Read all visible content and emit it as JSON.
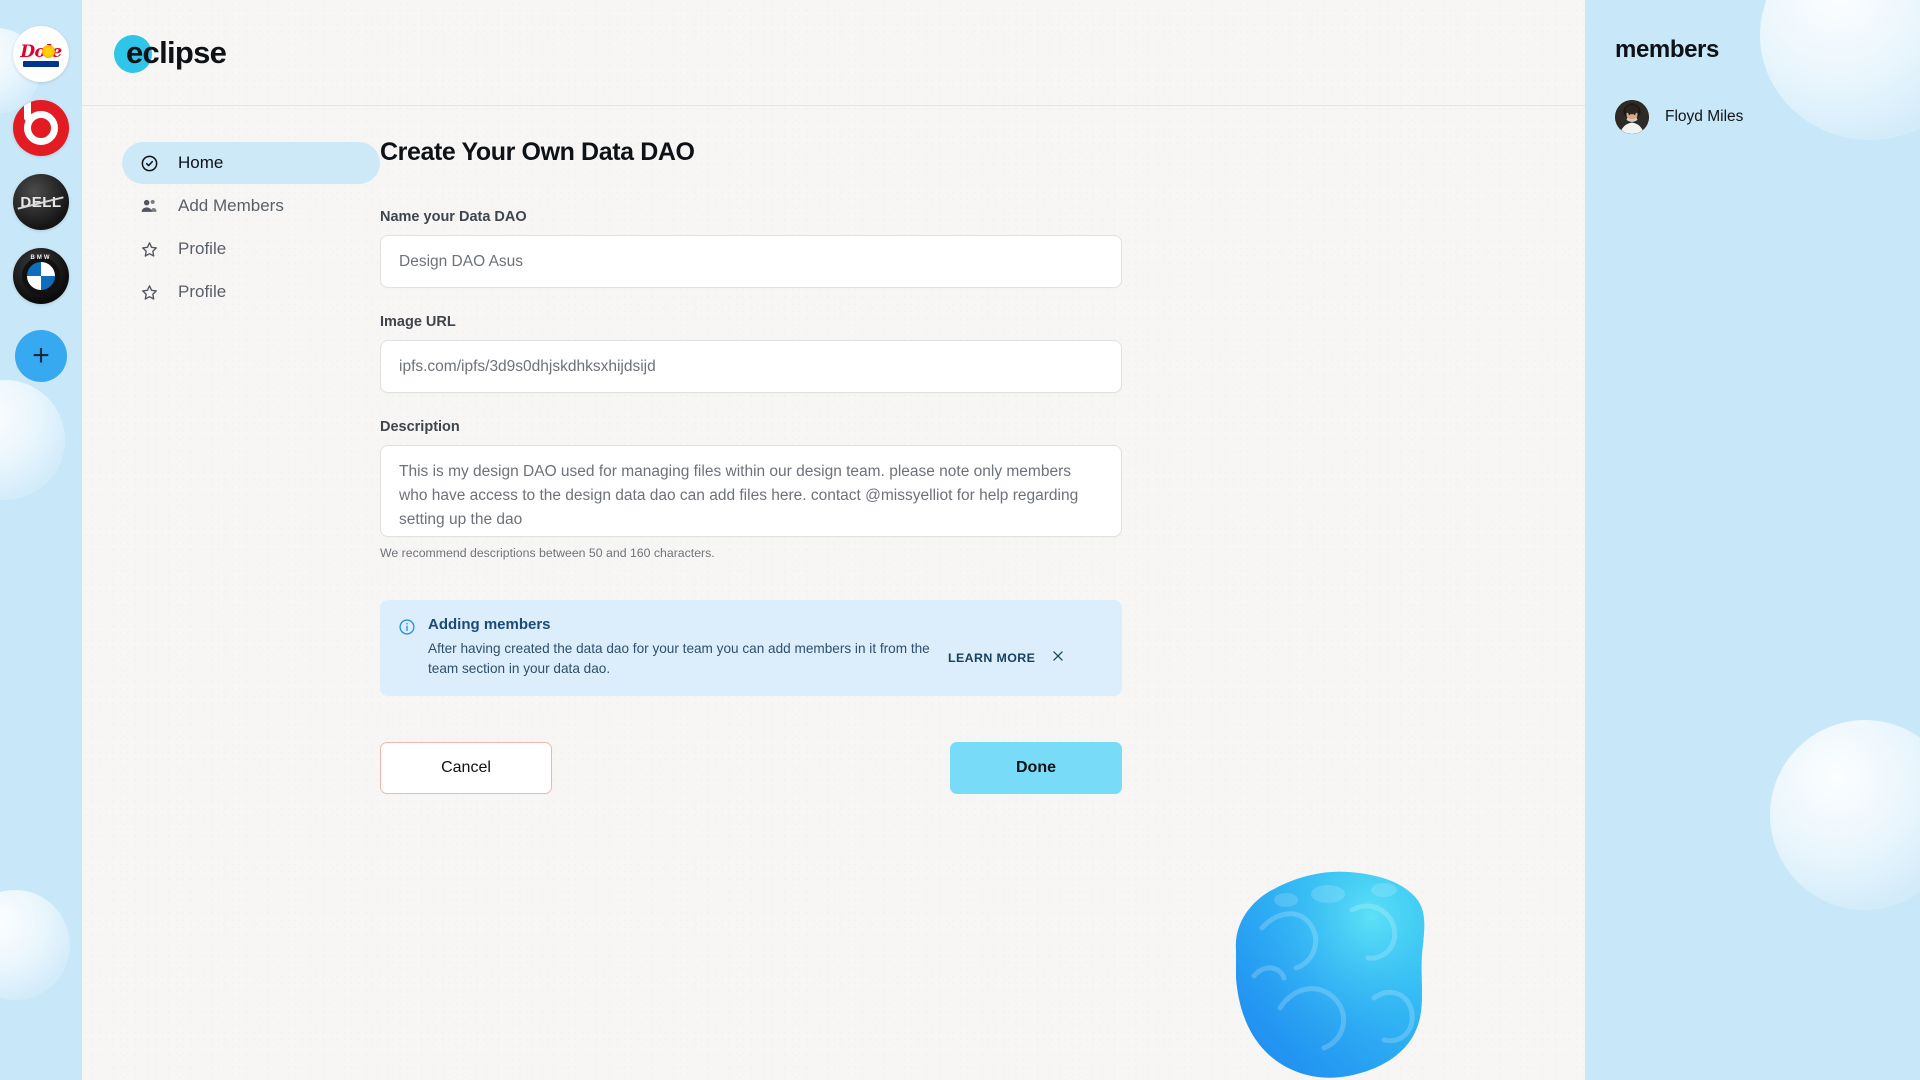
{
  "colors": {
    "page_background": "#c8e7f8",
    "panel_background": "#f7f6f5",
    "accent_cyan": "#2ec5e8",
    "nav_active_pill": "#cde9f8",
    "banner_background": "#dceefc",
    "done_button": "#78dcf8",
    "cancel_border": "#f0b6ae",
    "add_button": "#36a9f0"
  },
  "app_rail": {
    "logos": [
      {
        "name": "dole-logo",
        "label": "Dole"
      },
      {
        "name": "beats-logo",
        "label": "Beats"
      },
      {
        "name": "dell-logo",
        "label": "DELL"
      },
      {
        "name": "bmw-logo",
        "label": "BMW"
      }
    ],
    "add_button_label": "+"
  },
  "header": {
    "logo_text": "eclipse",
    "logo_icon": "circle-dot-icon"
  },
  "sidebar": {
    "items": [
      {
        "label": "Home",
        "icon": "check-circle-icon",
        "active": true
      },
      {
        "label": "Add Members",
        "icon": "people-icon",
        "active": false
      },
      {
        "label": "Profile",
        "icon": "star-icon",
        "active": false
      },
      {
        "label": "Profile",
        "icon": "star-icon",
        "active": false
      }
    ]
  },
  "form": {
    "title": "Create Your Own Data DAO",
    "name_field": {
      "label": "Name your Data DAO",
      "value": "Design DAO Asus",
      "placeholder": "Design DAO Asus"
    },
    "image_url_field": {
      "label": "Image URL",
      "value": "ipfs.com/ipfs/3d9s0dhjskdhksxhijdsijd",
      "placeholder": "ipfs.com/ipfs/3d9s0dhjskdhksxhijdsijd"
    },
    "description_field": {
      "label": "Description",
      "value": "This is my design DAO used for managing files within our design team. please note only members who have access to the design data dao can add files here. contact @missyelliot for help regarding setting up the dao",
      "placeholder": "This is my design DAO used for managing files within our design team.",
      "hint": "We recommend descriptions between 50 and 160 characters."
    }
  },
  "banner": {
    "icon": "info-circle-icon",
    "title": "Adding members",
    "text": "After having created the data dao for your team you can add members in it from the team section in your data dao.",
    "learn_more_label": "LEARN MORE",
    "close_icon": "close-icon"
  },
  "actions": {
    "cancel_label": "Cancel",
    "done_label": "Done"
  },
  "members_panel": {
    "title": "members",
    "members": [
      {
        "name": "Floyd Miles",
        "avatar": "user-photo-avatar"
      }
    ]
  },
  "artwork": {
    "blob_name": "blue-3d-blob-artwork"
  }
}
